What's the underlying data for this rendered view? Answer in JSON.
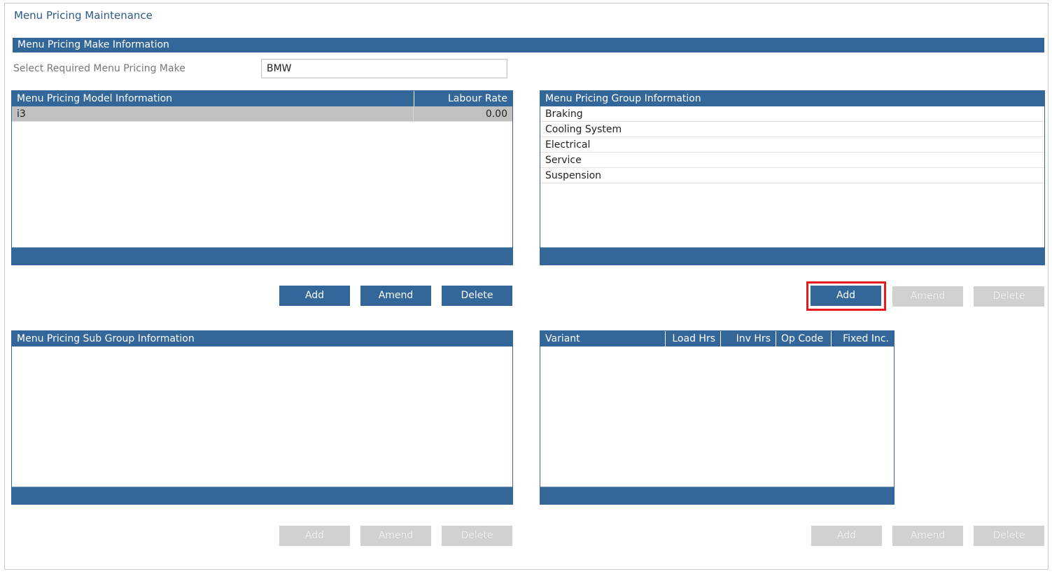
{
  "page": {
    "title": "Menu Pricing Maintenance"
  },
  "make_section": {
    "header": "Menu Pricing Make Information",
    "select_label": "Select Required Menu Pricing Make",
    "make_value": "BMW"
  },
  "model_grid": {
    "columns": [
      "Menu Pricing Model Information",
      "Labour Rate"
    ],
    "rows": [
      {
        "model": "i3",
        "labour_rate": "0.00",
        "selected": true
      }
    ],
    "buttons": {
      "add": "Add",
      "amend": "Amend",
      "delete": "Delete"
    }
  },
  "group_grid": {
    "columns": [
      "Menu Pricing Group Information"
    ],
    "rows": [
      "Braking",
      "Cooling System",
      "Electrical",
      "Service",
      "Suspension"
    ],
    "buttons": {
      "add": "Add",
      "amend": "Amend",
      "delete": "Delete"
    }
  },
  "subgroup_grid": {
    "columns": [
      "Menu Pricing Sub Group Information"
    ],
    "rows": [],
    "buttons": {
      "add": "Add",
      "amend": "Amend",
      "delete": "Delete"
    }
  },
  "variant_grid": {
    "columns": [
      "Variant",
      "Load Hrs",
      "Inv Hrs",
      "Op Code",
      "Fixed Inc."
    ],
    "rows": [],
    "buttons": {
      "add": "Add",
      "amend": "Amend",
      "delete": "Delete"
    }
  },
  "colors": {
    "header_blue": "#336699",
    "highlight_red": "#e8191c",
    "disabled_gray": "#d1d1d1"
  }
}
